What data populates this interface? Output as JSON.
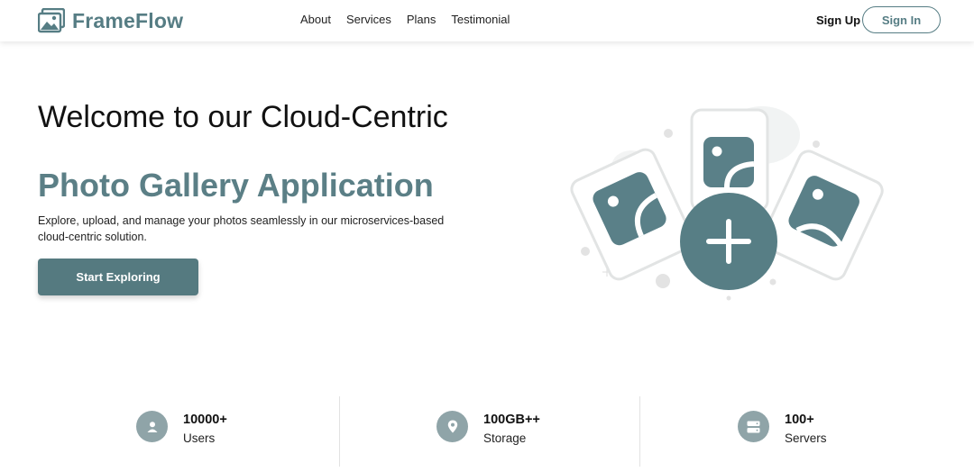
{
  "brand": {
    "name": "FrameFlow"
  },
  "nav": {
    "links": [
      "About",
      "Services",
      "Plans",
      "Testimonial"
    ]
  },
  "auth": {
    "signup_label": "Sign Up",
    "signin_label": "Sign In"
  },
  "hero": {
    "title": "Welcome to our Cloud-Centric",
    "subtitle": "Photo Gallery Application",
    "description": "Explore, upload, and manage your photos seamlessly in our microservices-based cloud-centric solution.",
    "cta_label": "Start Exploring"
  },
  "stats": [
    {
      "icon": "user-icon",
      "value": "10000+",
      "label": "Users"
    },
    {
      "icon": "location-pin-icon",
      "value": "100GB++",
      "label": "Storage"
    },
    {
      "icon": "server-icon",
      "value": "100+",
      "label": "Servers"
    }
  ],
  "colors": {
    "accent": "#567d84",
    "icon_circle": "#8fa4a8",
    "button": "#557a80"
  }
}
